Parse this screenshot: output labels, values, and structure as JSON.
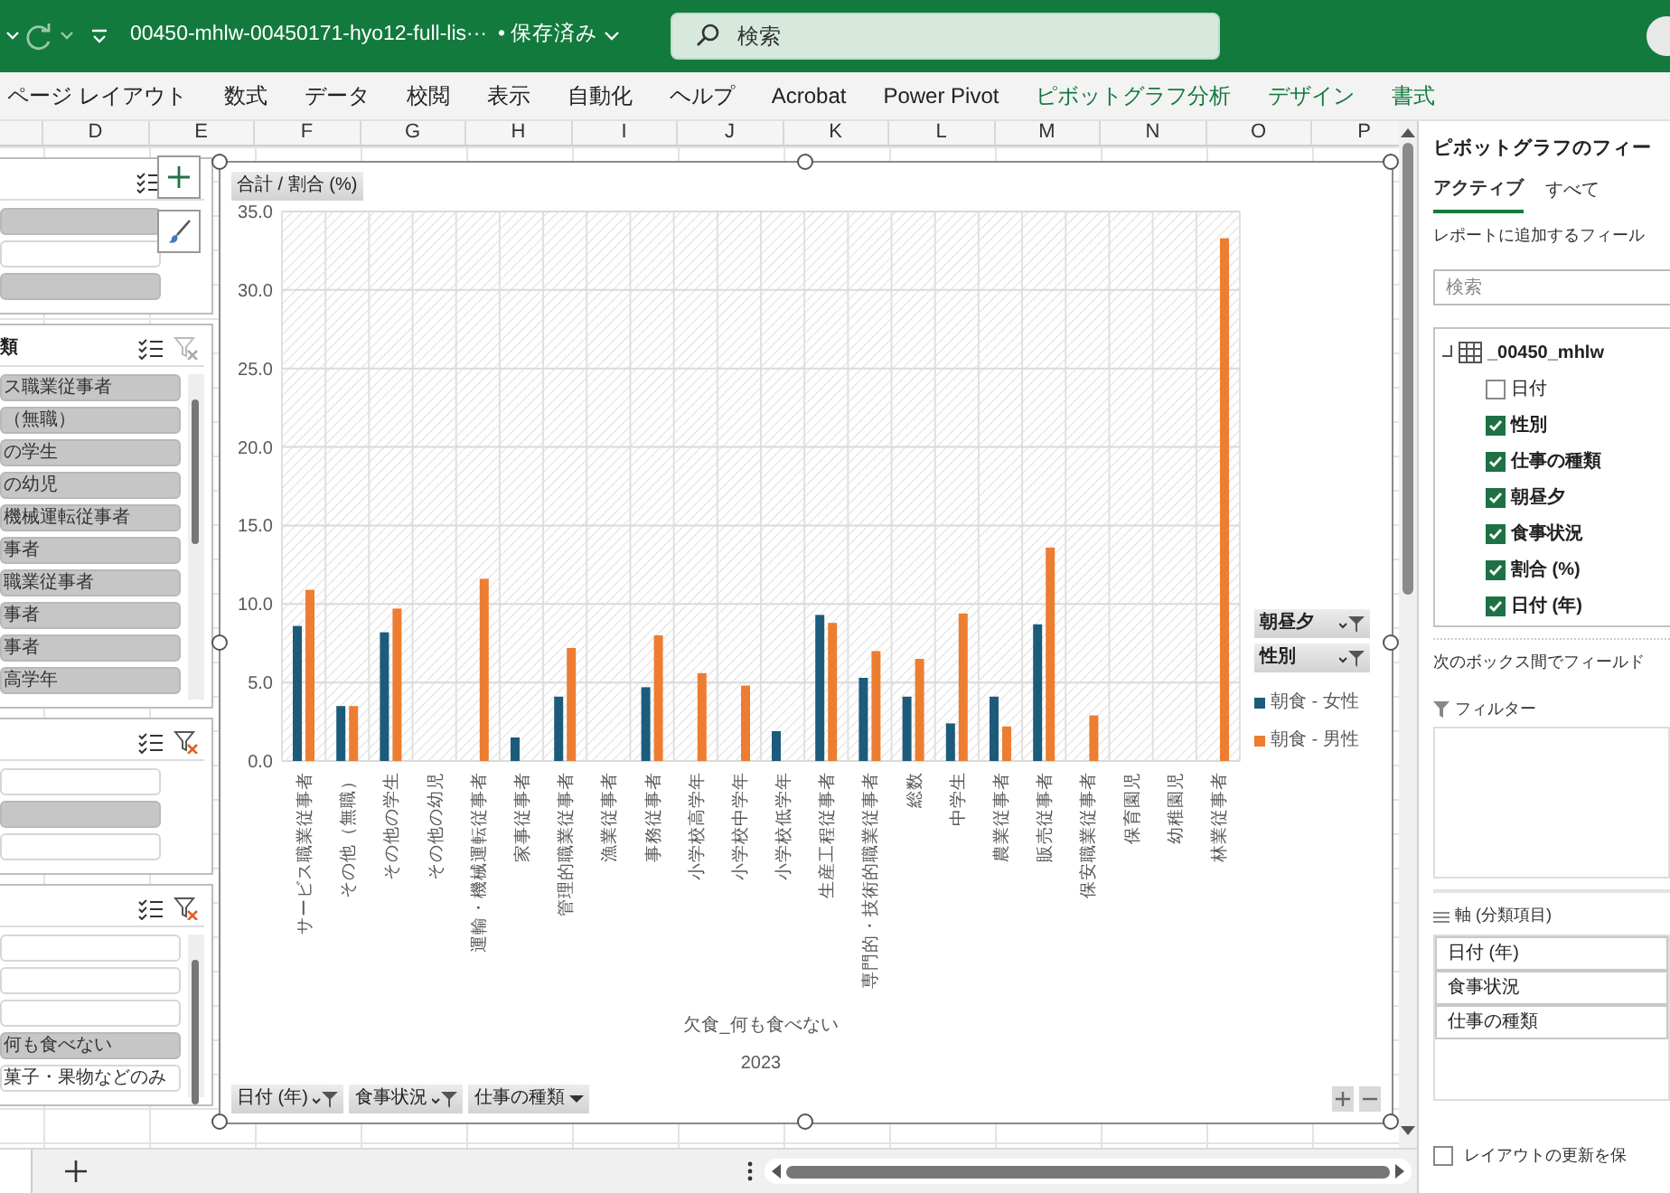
{
  "title_bar": {
    "file_name": "00450-mhlw-00450171-hyo12-full-lis···",
    "save_status": "• 保存済み",
    "search": {
      "placeholder": "検索"
    }
  },
  "ribbon_tabs": [
    {
      "label": "ページ レイアウト",
      "kind": "standard"
    },
    {
      "label": "数式",
      "kind": "standard"
    },
    {
      "label": "データ",
      "kind": "standard"
    },
    {
      "label": "校閲",
      "kind": "standard"
    },
    {
      "label": "表示",
      "kind": "standard"
    },
    {
      "label": "自動化",
      "kind": "standard"
    },
    {
      "label": "ヘルプ",
      "kind": "standard"
    },
    {
      "label": "Acrobat",
      "kind": "standard"
    },
    {
      "label": "Power Pivot",
      "kind": "standard"
    },
    {
      "label": "ピボットグラフ分析",
      "kind": "contextual"
    },
    {
      "label": "デザイン",
      "kind": "contextual"
    },
    {
      "label": "書式",
      "kind": "contextual"
    }
  ],
  "column_headers": [
    "D",
    "E",
    "F",
    "G",
    "H",
    "I",
    "J",
    "K",
    "L",
    "M",
    "N",
    "O",
    "P"
  ],
  "slicers": [
    {
      "scrollbar": false,
      "items": [
        {
          "selected": true
        },
        {
          "selected": false
        },
        {
          "selected": true
        }
      ]
    },
    {
      "title": "類",
      "filtered": false,
      "scrollbar": true,
      "items": [
        {
          "label": "ス職業従事者",
          "selected": true
        },
        {
          "label": "（無職）",
          "selected": true
        },
        {
          "label": "の学生",
          "selected": true
        },
        {
          "label": "の幼児",
          "selected": true
        },
        {
          "label": "機械運転従事者",
          "selected": true
        },
        {
          "label": "事者",
          "selected": true
        },
        {
          "label": "職業従事者",
          "selected": true
        },
        {
          "label": "事者",
          "selected": true
        },
        {
          "label": "事者",
          "selected": true
        },
        {
          "label": "高学年",
          "selected": true
        }
      ]
    },
    {
      "filtered": true,
      "scrollbar": false,
      "items": [
        {
          "selected": false
        },
        {
          "selected": true
        },
        {
          "selected": false
        }
      ]
    },
    {
      "filtered": true,
      "scrollbar": true,
      "items": [
        {
          "selected": false
        },
        {
          "selected": false
        },
        {
          "selected": false
        },
        {
          "label": "何も食べない",
          "selected": true
        },
        {
          "label": "菓子・果物などのみ",
          "selected": false
        }
      ]
    }
  ],
  "chart": {
    "value_field_button": "合計 / 割合 (%)",
    "chart_data": {
      "type": "bar",
      "categories": [
        "サービス職業従事者",
        "その他（無職）",
        "その他の学生",
        "その他の幼児",
        "運輸・機械運転従事者",
        "家事従事者",
        "管理的職業従事者",
        "漁業従事者",
        "事務従事者",
        "小学校高学年",
        "小学校中学年",
        "小学校低学年",
        "生産工程従事者",
        "専門的・技術的職業従事者",
        "総数",
        "中学生",
        "農業従事者",
        "販売従事者",
        "保安職業従事者",
        "保育園児",
        "幼稚園児",
        "林業従事者"
      ],
      "series": [
        {
          "name": "朝食 - 女性",
          "color": "#1d5b7b",
          "values": [
            8.6,
            3.5,
            8.2,
            null,
            null,
            1.5,
            4.1,
            null,
            4.7,
            null,
            null,
            1.9,
            9.3,
            5.3,
            4.1,
            2.4,
            4.1,
            8.7,
            null,
            null,
            null,
            null
          ]
        },
        {
          "name": "朝食 - 男性",
          "color": "#ed7d31",
          "values": [
            10.9,
            3.5,
            9.7,
            null,
            11.6,
            null,
            7.2,
            null,
            8.0,
            5.6,
            4.8,
            null,
            8.8,
            7.0,
            6.5,
            9.4,
            2.2,
            13.6,
            2.9,
            null,
            null,
            33.3
          ]
        }
      ],
      "ylim": [
        0,
        35
      ],
      "grid": true,
      "yticks": [
        {
          "value": 0,
          "label": "0.0"
        },
        {
          "value": 5,
          "label": "5.0"
        },
        {
          "value": 10,
          "label": "10.0"
        },
        {
          "value": 15,
          "label": "15.0"
        },
        {
          "value": 20,
          "label": "20.0"
        },
        {
          "value": 25,
          "label": "25.0"
        },
        {
          "value": 30,
          "label": "30.0"
        },
        {
          "value": 35,
          "label": "35.0"
        }
      ]
    },
    "axis_group_labels": [
      "欠食_何も食べない",
      "2023"
    ],
    "legend_field_buttons": [
      "朝昼夕",
      "性別"
    ],
    "axis_field_buttons": [
      {
        "label": "日付 (年)",
        "filtered": true
      },
      {
        "label": "食事状況",
        "filtered": true
      },
      {
        "label": "仕事の種類",
        "filtered": false
      }
    ]
  },
  "field_pane": {
    "title": "ピボットグラフのフィー",
    "tabs": [
      {
        "label": "アクティブ",
        "selected": true
      },
      {
        "label": "すべて",
        "selected": false
      }
    ],
    "instruction": "レポートに追加するフィール",
    "search": {
      "placeholder": "検索"
    },
    "table_name": "_00450_mhlw",
    "fields": [
      {
        "label": "日付",
        "checked": false
      },
      {
        "label": "性別",
        "checked": true
      },
      {
        "label": "仕事の種類",
        "checked": true
      },
      {
        "label": "朝昼夕",
        "checked": true
      },
      {
        "label": "食事状況",
        "checked": true
      },
      {
        "label": "割合 (%)",
        "checked": true
      },
      {
        "label": "日付 (年)",
        "checked": true
      }
    ],
    "areas_hint": "次のボックス間でフィールド",
    "filter_area": {
      "title": "フィルター"
    },
    "axis_area": {
      "title": "軸 (分類項目)",
      "items": [
        "日付 (年)",
        "食事状況",
        "仕事の種類"
      ]
    },
    "defer_update": {
      "label": "レイアウトの更新を保",
      "checked": false
    }
  }
}
